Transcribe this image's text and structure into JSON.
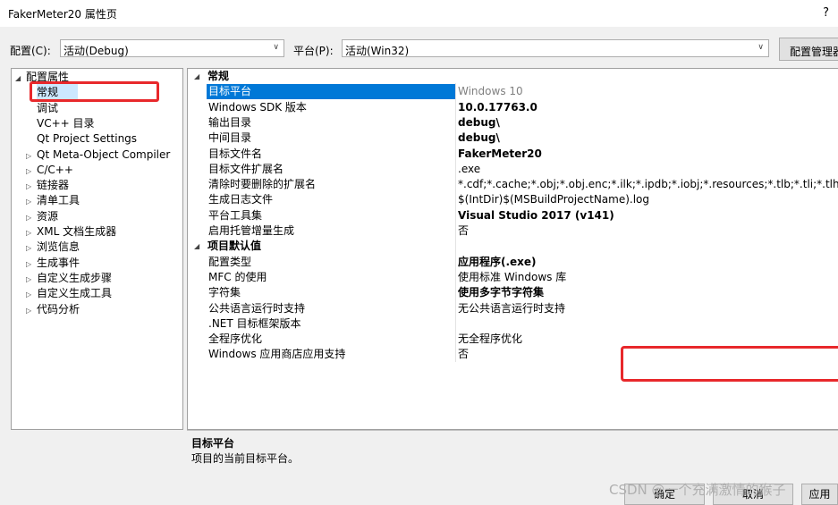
{
  "window": {
    "title": "FakerMeter20 属性页",
    "help": "?"
  },
  "toolbar": {
    "config_label": "配置(C):",
    "config_value": "活动(Debug)",
    "platform_label": "平台(P):",
    "platform_value": "活动(Win32)",
    "manager_button": "配置管理器"
  },
  "tree": {
    "items": [
      {
        "label": "配置属性",
        "twisty": "◢"
      },
      {
        "label": "常规",
        "twisty": ""
      },
      {
        "label": "调试",
        "twisty": ""
      },
      {
        "label": "VC++ 目录",
        "twisty": ""
      },
      {
        "label": "Qt Project Settings",
        "twisty": ""
      },
      {
        "label": "Qt Meta-Object Compiler",
        "twisty": "▷"
      },
      {
        "label": "C/C++",
        "twisty": "▷"
      },
      {
        "label": "链接器",
        "twisty": "▷"
      },
      {
        "label": "清单工具",
        "twisty": "▷"
      },
      {
        "label": "资源",
        "twisty": "▷"
      },
      {
        "label": "XML 文档生成器",
        "twisty": "▷"
      },
      {
        "label": "浏览信息",
        "twisty": "▷"
      },
      {
        "label": "生成事件",
        "twisty": "▷"
      },
      {
        "label": "自定义生成步骤",
        "twisty": "▷"
      },
      {
        "label": "自定义生成工具",
        "twisty": "▷"
      },
      {
        "label": "代码分析",
        "twisty": "▷"
      }
    ]
  },
  "grid": {
    "cat_general": "常规",
    "cat_project_defaults": "项目默认值",
    "twisty": "◢",
    "general_rows": [
      {
        "name": "目标平台",
        "value": "Windows 10"
      },
      {
        "name": "Windows SDK 版本",
        "value": "10.0.17763.0"
      },
      {
        "name": "输出目录",
        "value": "debug\\"
      },
      {
        "name": "中间目录",
        "value": "debug\\"
      },
      {
        "name": "目标文件名",
        "value": "FakerMeter20"
      },
      {
        "name": "目标文件扩展名",
        "value": ".exe"
      },
      {
        "name": "清除时要删除的扩展名",
        "value": "*.cdf;*.cache;*.obj;*.obj.enc;*.ilk;*.ipdb;*.iobj;*.resources;*.tlb;*.tli;*.tlh;*.tmp;*"
      },
      {
        "name": "生成日志文件",
        "value": "$(IntDir)$(MSBuildProjectName).log"
      },
      {
        "name": "平台工具集",
        "value": "Visual Studio 2017 (v141)"
      },
      {
        "name": "启用托管增量生成",
        "value": "否"
      }
    ],
    "default_rows": [
      {
        "name": "配置类型",
        "value": "应用程序(.exe)"
      },
      {
        "name": "MFC 的使用",
        "value": "使用标准 Windows 库"
      },
      {
        "name": "字符集",
        "value": "使用多字节字符集"
      },
      {
        "name": "公共语言运行时支持",
        "value": "无公共语言运行时支持"
      },
      {
        "name": ".NET 目标框架版本",
        "value": ""
      },
      {
        "name": "全程序优化",
        "value": "无全程序优化"
      },
      {
        "name": "Windows 应用商店应用支持",
        "value": "否"
      }
    ]
  },
  "description": {
    "title": "目标平台",
    "text": "项目的当前目标平台。"
  },
  "buttons": {
    "ok": "确定",
    "cancel": "取消",
    "apply": "应用"
  },
  "watermark": "CSDN @一个充满激情的猴子",
  "colors": {
    "selection": "#0078d7",
    "highlight_box": "#e8282b",
    "tree_selection": "#cce8ff"
  }
}
